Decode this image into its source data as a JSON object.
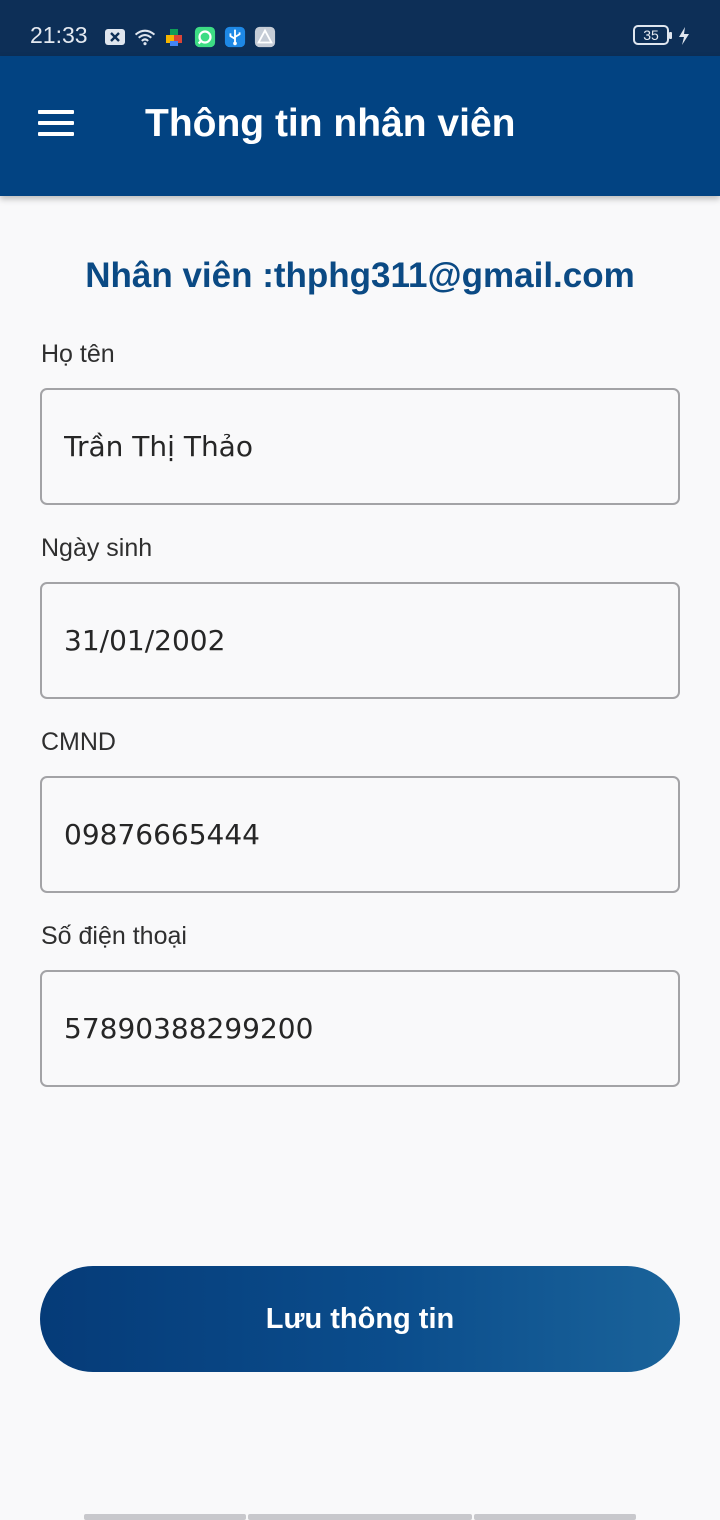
{
  "status_bar": {
    "time": "21:33",
    "battery_level": "35",
    "icons": [
      "notification-x-icon",
      "wifi-icon",
      "puzzle-app-icon",
      "green-app-icon",
      "usb-icon",
      "warning-icon",
      "charging-icon"
    ]
  },
  "app_bar": {
    "title": "Thông tin nhân viên",
    "menu_icon": "hamburger-menu-icon",
    "background_color": "#024382"
  },
  "employee": {
    "heading": "Nhân viên :thphg311@gmail.com"
  },
  "form": {
    "full_name": {
      "label": "Họ tên",
      "value": "Trần Thị Thảo"
    },
    "birth_date": {
      "label": "Ngày sinh",
      "value": "31/01/2002"
    },
    "id_number": {
      "label": "CMND",
      "value": "09876665444"
    },
    "phone": {
      "label": "Số điện thoại",
      "value": "57890388299200"
    }
  },
  "save_button": {
    "label": "Lưu thông tin"
  },
  "colors": {
    "primary": "#024382",
    "heading_text": "#0b4a84",
    "background": "#f9f9fa"
  }
}
